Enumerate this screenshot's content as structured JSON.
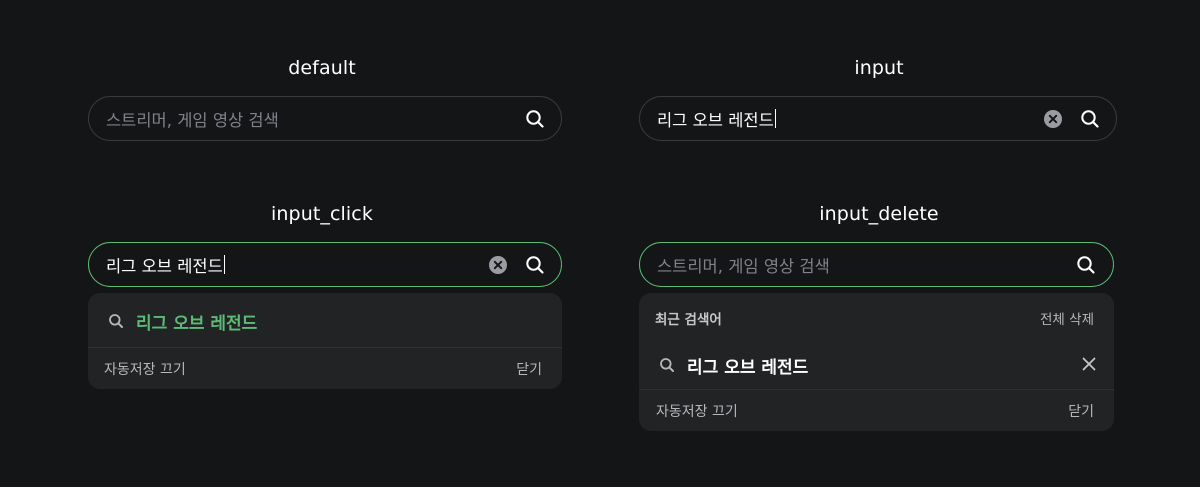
{
  "states": {
    "default": {
      "title": "default",
      "placeholder": "스트리머, 게임 영상 검색"
    },
    "input": {
      "title": "input",
      "value": "리그 오브 레전드"
    },
    "input_click": {
      "title": "input_click",
      "value": "리그 오브 레전드",
      "suggestion": "리그 오브 레전드",
      "autosave_label": "자동저장 끄기",
      "close_label": "닫기"
    },
    "input_delete": {
      "title": "input_delete",
      "placeholder": "스트리머, 게임 영상 검색",
      "recent_label": "최근 검색어",
      "delete_all_label": "전체 삭제",
      "recent_item": "리그 오브 레전드",
      "autosave_label": "자동저장 끄기",
      "close_label": "닫기"
    }
  },
  "colors": {
    "background": "#141517",
    "border": "#3a3b3e",
    "focus_border": "#5cbc77",
    "accent_green": "#5cbc77",
    "dropdown_bg": "#222325",
    "placeholder": "#808289"
  },
  "icons": {
    "search": "search-icon",
    "clear": "clear-circle-icon",
    "close": "close-icon"
  }
}
